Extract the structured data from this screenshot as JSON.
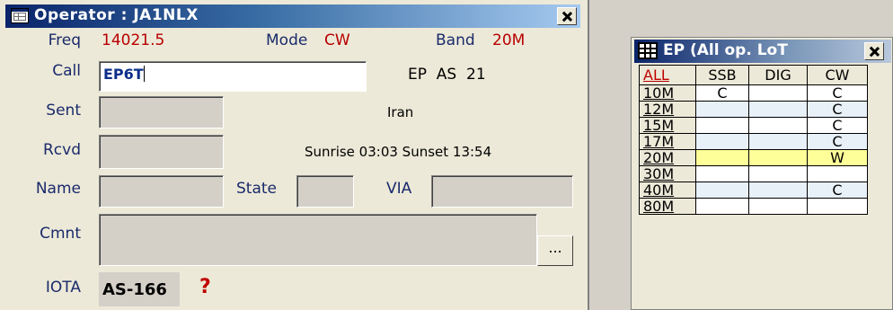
{
  "operator_window": {
    "title": "Operator : JA1NLX",
    "labels": {
      "freq": "Freq",
      "mode": "Mode",
      "band": "Band",
      "call": "Call",
      "sent": "Sent",
      "rcvd": "Rcvd",
      "name": "Name",
      "state": "State",
      "via": "VIA",
      "cmnt": "Cmnt",
      "iota": "IOTA"
    },
    "freq_value": "14021.5",
    "mode_value": "CW",
    "band_value": "20M",
    "call_value": "EP6T",
    "entity_info": "EP  AS  21",
    "country": "Iran",
    "sun_times": "Sunrise 03:03 Sunset 13:54",
    "iota_value": "AS-166",
    "iota_hint": "?",
    "dots_button": "..."
  },
  "ep_window": {
    "title": "EP (All op. LoT",
    "headers": [
      "ALL",
      "SSB",
      "DIG",
      "CW"
    ],
    "rows": [
      {
        "band": "10M",
        "ssb": "C",
        "dig": "",
        "cw": "C"
      },
      {
        "band": "12M",
        "ssb": "",
        "dig": "",
        "cw": "C"
      },
      {
        "band": "15M",
        "ssb": "",
        "dig": "",
        "cw": "C"
      },
      {
        "band": "17M",
        "ssb": "",
        "dig": "",
        "cw": "C"
      },
      {
        "band": "20M",
        "ssb": "",
        "dig": "",
        "cw": "W"
      },
      {
        "band": "30M",
        "ssb": "",
        "dig": "",
        "cw": ""
      },
      {
        "band": "40M",
        "ssb": "",
        "dig": "",
        "cw": "C"
      },
      {
        "band": "80M",
        "ssb": "",
        "dig": "",
        "cw": ""
      }
    ]
  },
  "colors": {
    "title_bar": "#0a246a",
    "value_red": "#b80000",
    "highlight_row": "#ffff99"
  }
}
